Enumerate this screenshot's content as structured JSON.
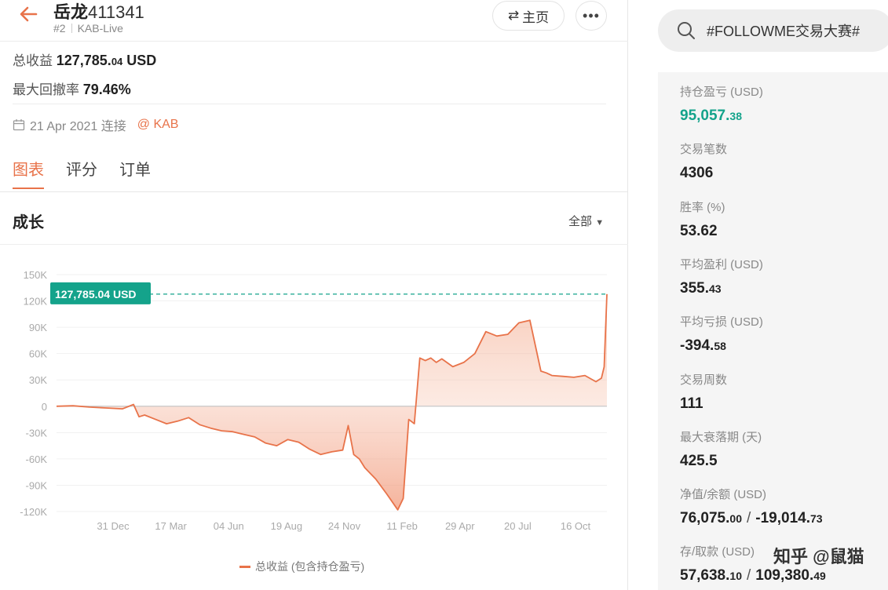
{
  "header": {
    "title_name": "岳龙",
    "title_num": "411341",
    "rank": "#2",
    "account_type": "KAB-Live",
    "home_label": "主页",
    "more_label": "•••"
  },
  "summary": {
    "total_label": "总收益",
    "total_value_main": "127,785.",
    "total_value_dec": "04",
    "total_unit": " USD",
    "drawdown_label": "最大回撤率",
    "drawdown_value": "79.46%",
    "connect_date": "21 Apr 2021 连接",
    "broker": "@ KAB"
  },
  "tabs": [
    {
      "label": "图表"
    },
    {
      "label": "评分"
    },
    {
      "label": "订单"
    }
  ],
  "section": {
    "title": "成长",
    "range": "全部"
  },
  "colors": {
    "accent": "#e8734a",
    "green": "#14a38b",
    "line": "#e8734a"
  },
  "chart_data": {
    "type": "area",
    "title": "",
    "legend": [
      "总收益 (包含持仓盈亏)"
    ],
    "callout": "127,785.04 USD",
    "ylim": [
      -120000,
      150000
    ],
    "y_ticks": [
      "150K",
      "120K",
      "90K",
      "60K",
      "30K",
      "0",
      "-30K",
      "-60K",
      "-90K",
      "-120K"
    ],
    "x_ticks": [
      "31 Dec",
      "17 Mar",
      "04 Jun",
      "19 Aug",
      "24 Nov",
      "11 Feb",
      "29 Apr",
      "20 Jul",
      "16 Oct"
    ],
    "x_range": [
      0,
      100
    ],
    "series": [
      {
        "x": [
          0,
          3,
          6,
          9,
          12,
          14,
          15,
          16,
          18,
          20,
          22,
          24,
          26,
          28,
          30,
          32,
          34,
          36,
          38,
          40,
          42,
          44,
          46,
          48,
          50,
          52,
          53,
          54,
          55,
          56,
          58,
          60,
          62,
          63,
          64,
          65,
          66,
          67,
          68,
          69,
          70,
          72,
          74,
          76,
          78,
          80,
          82,
          84,
          86,
          88,
          89,
          90,
          92,
          94,
          96,
          98,
          99,
          99.5,
          100
        ],
        "y": [
          0,
          500,
          -1000,
          -2000,
          -3000,
          2000,
          -12000,
          -10000,
          -15000,
          -20000,
          -17000,
          -13000,
          -21000,
          -25000,
          -28000,
          -29000,
          -32000,
          -35000,
          -42000,
          -45000,
          -38000,
          -41000,
          -49000,
          -55000,
          -52000,
          -50000,
          -22000,
          -55000,
          -60000,
          -70000,
          -83000,
          -100000,
          -118000,
          -105000,
          -15000,
          -20000,
          55000,
          52000,
          55000,
          50000,
          54000,
          45000,
          50000,
          60000,
          85000,
          80000,
          82000,
          95000,
          98000,
          40000,
          38000,
          35000,
          34000,
          33000,
          35000,
          28000,
          32000,
          45000,
          127785
        ]
      }
    ]
  },
  "search": {
    "placeholder": "#FOLLOWME交易大赛#"
  },
  "stats": [
    {
      "label": "持仓盈亏 (USD)",
      "main": "95,057.",
      "dec": "38",
      "green": true
    },
    {
      "label": "交易笔数",
      "main": "4306",
      "dec": ""
    },
    {
      "label": "胜率 (%)",
      "main": "53.62",
      "dec": ""
    },
    {
      "label": "平均盈利 (USD)",
      "main": "355.",
      "dec": "43"
    },
    {
      "label": "平均亏损 (USD)",
      "main": "-394.",
      "dec": "58"
    },
    {
      "label": "交易周数",
      "main": "111",
      "dec": ""
    },
    {
      "label": "最大衰落期 (天)",
      "main": "425.5",
      "dec": ""
    }
  ],
  "equity": {
    "label": "净值/余额 (USD)",
    "a_main": "76,075.",
    "a_dec": "00",
    "b_main": "-19,014.",
    "b_dec": "73"
  },
  "deposit": {
    "label": "存/取款 (USD)",
    "a_main": "57,638.",
    "a_dec": "10",
    "b_main": "109,380.",
    "b_dec": "49"
  },
  "watermark": "知乎 @鼠猫"
}
